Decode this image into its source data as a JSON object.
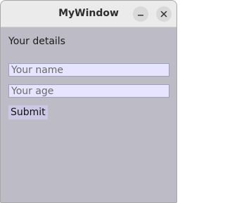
{
  "window": {
    "title": "MyWindow",
    "buttons": {
      "minimize_icon": "minimize-icon",
      "close_icon": "close-icon"
    }
  },
  "form": {
    "heading": "Your details",
    "name_field": {
      "placeholder": "Your name",
      "value": ""
    },
    "age_field": {
      "placeholder": "Your age",
      "value": ""
    },
    "submit_label": "Submit"
  },
  "colors": {
    "background": "#bdbcc6",
    "input_background": "#e6e4ff",
    "button_background": "#ccc8e4",
    "titlebar": "#ebebeb"
  }
}
